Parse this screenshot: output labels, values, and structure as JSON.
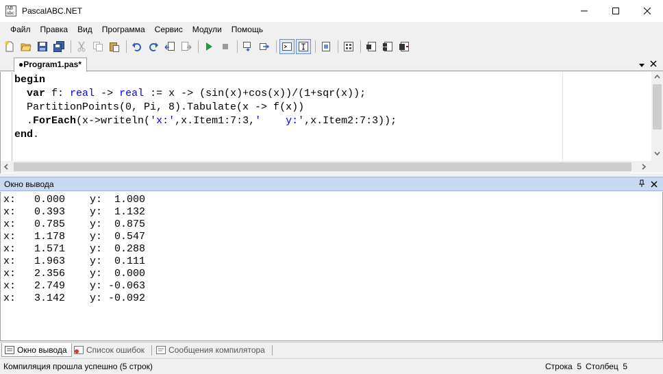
{
  "window": {
    "title": "PascalABC.NET",
    "icon_text": "AB abc",
    "controls": [
      "minimize-icon",
      "maximize-icon",
      "close-icon"
    ]
  },
  "menu": [
    "Файл",
    "Правка",
    "Вид",
    "Программа",
    "Сервис",
    "Модули",
    "Помощь"
  ],
  "toolbar": {
    "buttons": [
      "new-file-icon",
      "open-folder-icon",
      "save-icon",
      "save-all-icon",
      "cut-icon",
      "copy-icon",
      "paste-icon",
      "undo-icon",
      "redo-icon",
      "navigate-back-icon",
      "navigate-forward-icon",
      "run-icon",
      "stop-icon",
      "step-into-icon",
      "step-over-icon",
      "output-window-icon",
      "text-mode-icon",
      "document-icon",
      "form-designer-icon",
      "compile-icon",
      "build-icon",
      "rebuild-icon"
    ]
  },
  "editor": {
    "tab_label": "●Program1.pas*",
    "lines": [
      "begin",
      "  var f: real -> real := x -> (sin(x)+cos(x))/(1+sqr(x));",
      "  PartitionPoints(0, Pi, 8).Tabulate(x -> f(x))",
      "  .ForEach(x->writeln('x:',x.Item1:7:3,'    y:',x.Item2:7:3));",
      "end."
    ]
  },
  "output": {
    "title": "Окно вывода",
    "rows": [
      "x:   0.000    y:  1.000",
      "x:   0.393    y:  1.132",
      "x:   0.785    y:  0.875",
      "x:   1.178    y:  0.547",
      "x:   1.571    y:  0.288",
      "x:   1.963    y:  0.111",
      "x:   2.356    y:  0.000",
      "x:   2.749    y: -0.063",
      "x:   3.142    y: -0.092"
    ]
  },
  "bottom_tabs": [
    {
      "label": "Окно вывода",
      "active": true
    },
    {
      "label": "Список ошибок",
      "active": false
    },
    {
      "label": "Сообщения компилятора",
      "active": false
    }
  ],
  "status": {
    "message": "Компиляция прошла успешно (5 строк)",
    "row_label": "Строка",
    "row_value": "5",
    "col_label": "Столбец",
    "col_value": "5"
  },
  "colors": {
    "keyword_type": "#0000ff",
    "string": "#0000ff",
    "panel_header": "#c9daf0"
  }
}
